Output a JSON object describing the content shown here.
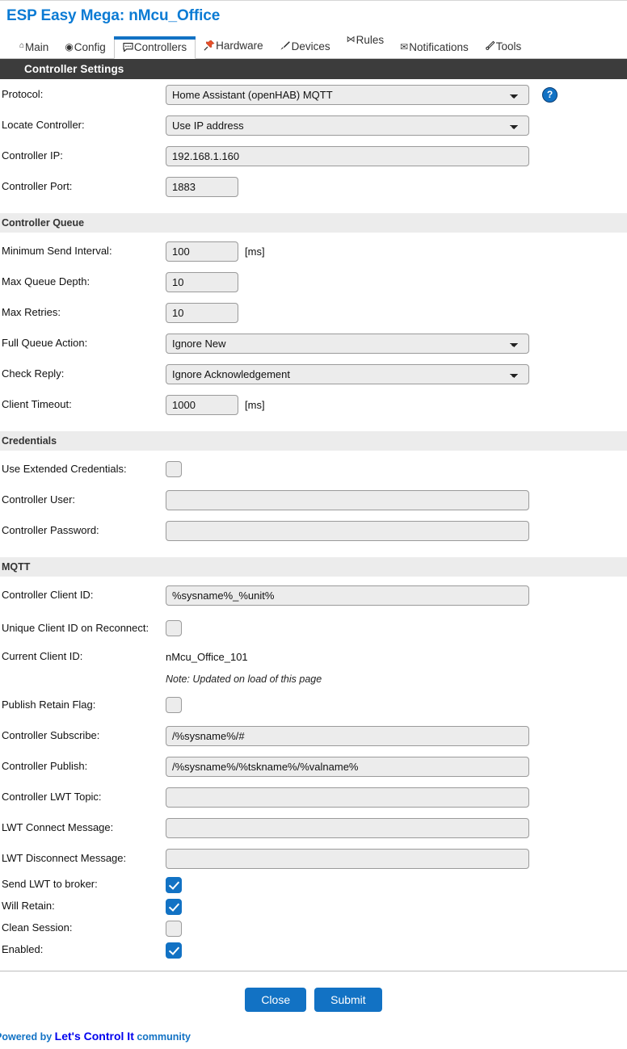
{
  "header": {
    "title": "ESP Easy Mega: nMcu_Office"
  },
  "nav": {
    "tabs": [
      {
        "label": "Main",
        "icon": "home-icon",
        "glyph": "⌂",
        "active": false
      },
      {
        "label": "Config",
        "icon": "gear-icon",
        "glyph": "⊙",
        "active": false
      },
      {
        "label": "Controllers",
        "icon": "chat-bubble-icon",
        "glyph": "💬",
        "active": true
      },
      {
        "label": "Hardware",
        "icon": "pushpin-icon",
        "glyph": "📌",
        "active": false
      },
      {
        "label": "Devices",
        "icon": "plug-icon",
        "glyph": "✒",
        "active": false
      },
      {
        "label": "Rules",
        "icon": "arrow-branch-icon",
        "glyph": "⊸",
        "active": false
      },
      {
        "label": "Notifications",
        "icon": "envelope-icon",
        "glyph": "✉",
        "active": false
      },
      {
        "label": "Tools",
        "icon": "wrench-icon",
        "glyph": "🖊",
        "active": false
      }
    ]
  },
  "main_section": {
    "title": "Controller Settings"
  },
  "controller_settings": {
    "protocol": {
      "label": "Protocol:",
      "value": "Home Assistant (openHAB) MQTT",
      "help_label": "?"
    },
    "locate": {
      "label": "Locate Controller:",
      "value": "Use IP address"
    },
    "ip": {
      "label": "Controller IP:",
      "value": "192.168.1.160"
    },
    "port": {
      "label": "Controller Port:",
      "value": "1883"
    }
  },
  "controller_queue": {
    "title": "Controller Queue",
    "min_send_interval": {
      "label": "Minimum Send Interval:",
      "value": "100",
      "unit": "[ms]"
    },
    "max_queue_depth": {
      "label": "Max Queue Depth:",
      "value": "10"
    },
    "max_retries": {
      "label": "Max Retries:",
      "value": "10"
    },
    "full_queue_action": {
      "label": "Full Queue Action:",
      "value": "Ignore New"
    },
    "check_reply": {
      "label": "Check Reply:",
      "value": "Ignore Acknowledgement"
    },
    "client_timeout": {
      "label": "Client Timeout:",
      "value": "1000",
      "unit": "[ms]"
    }
  },
  "credentials": {
    "title": "Credentials",
    "use_extended": {
      "label": "Use Extended Credentials:",
      "checked": false
    },
    "user": {
      "label": "Controller User:",
      "value": ""
    },
    "password": {
      "label": "Controller Password:",
      "value": ""
    }
  },
  "mqtt": {
    "title": "MQTT",
    "client_id": {
      "label": "Controller Client ID:",
      "value": "%sysname%_%unit%"
    },
    "unique_client_id": {
      "label": "Unique Client ID on Reconnect:",
      "checked": false
    },
    "current_client_id": {
      "label": "Current Client ID:",
      "value": "nMcu_Office_101",
      "note": "Note: Updated on load of this page"
    },
    "publish_retain": {
      "label": "Publish Retain Flag:",
      "checked": false
    },
    "subscribe": {
      "label": "Controller Subscribe:",
      "value": "/%sysname%/#"
    },
    "publish": {
      "label": "Controller Publish:",
      "value": "/%sysname%/%tskname%/%valname%"
    },
    "lwt_topic": {
      "label": "Controller LWT Topic:",
      "value": ""
    },
    "lwt_connect": {
      "label": "LWT Connect Message:",
      "value": ""
    },
    "lwt_disconnect": {
      "label": "LWT Disconnect Message:",
      "value": ""
    },
    "send_lwt": {
      "label": "Send LWT to broker:",
      "checked": true
    },
    "will_retain": {
      "label": "Will Retain:",
      "checked": true
    },
    "clean_session": {
      "label": "Clean Session:",
      "checked": false
    },
    "enabled": {
      "label": "Enabled:",
      "checked": true
    }
  },
  "footer": {
    "close_label": "Close",
    "submit_label": "Submit",
    "powered_prefix": "Powered by ",
    "powered_brand": "Let's Control It",
    "powered_suffix": " community"
  },
  "colors": {
    "accent": "#1272c4",
    "section_bar": "#3c3c3c",
    "subsection_bar": "#ececec",
    "field_bg": "#ececec",
    "title": "#0b7bd4"
  }
}
